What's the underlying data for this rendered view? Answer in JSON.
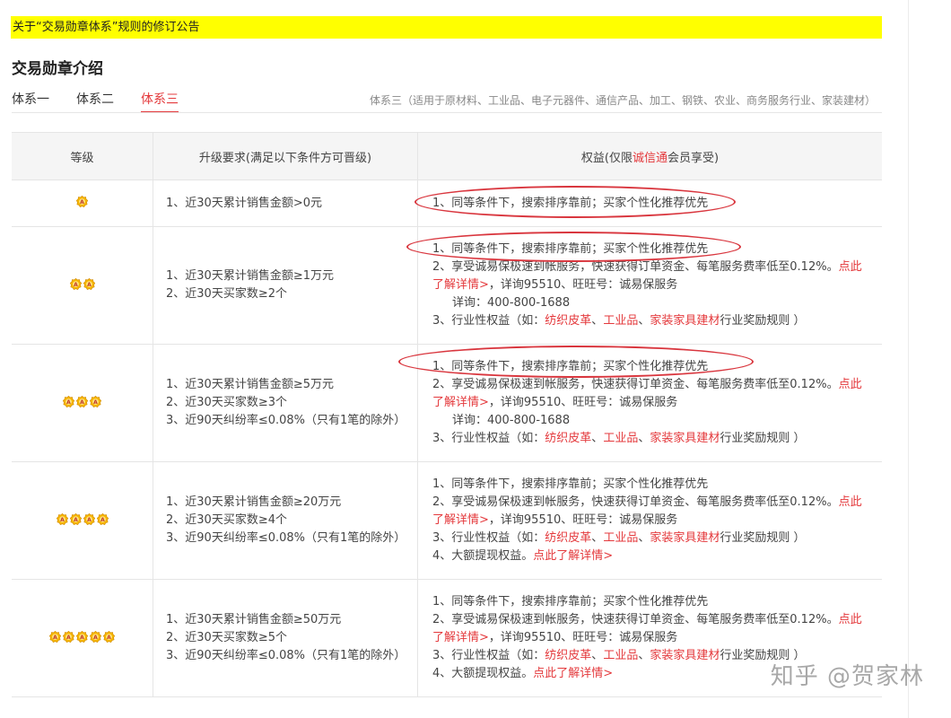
{
  "banner": {
    "text": "关于“交易勋章体系”规则的修订公告"
  },
  "section": {
    "title": "交易勋章介绍"
  },
  "tabs": [
    {
      "label": "体系一"
    },
    {
      "label": "体系二"
    },
    {
      "label": "体系三"
    }
  ],
  "tab_description": "体系三（适用于原材料、工业品、电子元器件、通信产品、加工、钢铁、农业、商务服务行业、家装建材）",
  "table": {
    "headers": {
      "level": "等级",
      "requirements": "升级要求(满足以下条件方可晋级)",
      "benefits_prefix": "权益(仅限",
      "benefits_highlight": "诚信通",
      "benefits_suffix": "会员享受)"
    },
    "rows": [
      {
        "medal_count": 1,
        "requirements": [
          "1、近30天累计销售金额>0元"
        ],
        "benefit_1": "1、同等条件下，搜索排序靠前；买家个性化推荐优先"
      },
      {
        "medal_count": 2,
        "requirements": [
          "1、近30天累计销售金额≥1万元",
          "2、近30天买家数≥2个"
        ],
        "benefit_1": "1、同等条件下，搜索排序靠前；买家个性化推荐优先",
        "benefit_2_text": "2、享受诚易保极速到帐服务，快速获得订单资金、每笔服务费率低至0.12%。",
        "benefit_2_link": "点此了解详情>",
        "benefit_2_tail": "，详询95510、旺旺号：诚易保服务",
        "benefit_2_extra": "详询：400-800-1688",
        "benefit_3_prefix": "3、行业性权益（如：",
        "benefit_3_links": [
          "纺织皮革",
          "工业品",
          "家装家具建材"
        ],
        "benefit_3_suffix": "行业奖励规则 ）"
      },
      {
        "medal_count": 3,
        "requirements": [
          "1、近30天累计销售金额≥5万元",
          "2、近30天买家数≥3个",
          "3、近90天纠纷率≤0.08%（只有1笔的除外）"
        ],
        "benefit_1": "1、同等条件下，搜索排序靠前；买家个性化推荐优先",
        "benefit_2_text": "2、享受诚易保极速到帐服务，快速获得订单资金、每笔服务费率低至0.12%。",
        "benefit_2_link": "点此了解详情>",
        "benefit_2_tail": "，详询95510、旺旺号：诚易保服务",
        "benefit_2_extra": "详询：400-800-1688",
        "benefit_3_prefix": "3、行业性权益（如：",
        "benefit_3_links": [
          "纺织皮革",
          "工业品",
          "家装家具建材"
        ],
        "benefit_3_suffix": "行业奖励规则 ）"
      },
      {
        "medal_count": 4,
        "requirements": [
          "1、近30天累计销售金额≥20万元",
          "2、近30天买家数≥4个",
          "3、近90天纠纷率≤0.08%（只有1笔的除外）"
        ],
        "benefit_1": "1、同等条件下，搜索排序靠前；买家个性化推荐优先",
        "benefit_2_text": "2、享受诚易保极速到帐服务，快速获得订单资金、每笔服务费率低至0.12%。",
        "benefit_2_link": "点此了解详情>",
        "benefit_2_tail": "，详询95510、旺旺号：诚易保服务",
        "benefit_3_prefix": "3、行业性权益（如：",
        "benefit_3_links": [
          "纺织皮革",
          "工业品",
          "家装家具建材"
        ],
        "benefit_3_suffix": "行业奖励规则 ）",
        "benefit_4_text": "4、大额提现权益。",
        "benefit_4_link": "点此了解详情>"
      },
      {
        "medal_count": 5,
        "requirements": [
          "1、近30天累计销售金额≥50万元",
          "2、近30天买家数≥5个",
          "3、近90天纠纷率≤0.08%（只有1笔的除外）"
        ],
        "benefit_1": "1、同等条件下，搜索排序靠前；买家个性化推荐优先",
        "benefit_2_text": "2、享受诚易保极速到帐服务，快速获得订单资金、每笔服务费率低至0.12%。",
        "benefit_2_link": "点此了解详情>",
        "benefit_2_tail": "，详询95510、旺旺号：诚易保服务",
        "benefit_3_prefix": "3、行业性权益（如：",
        "benefit_3_links": [
          "纺织皮革",
          "工业品",
          "家装家具建材"
        ],
        "benefit_3_suffix": "行业奖励规则 ）",
        "benefit_4_text": "4、大额提现权益。",
        "benefit_4_link": "点此了解详情>"
      }
    ]
  },
  "watermark": "知乎 @贺家林",
  "colors": {
    "banner_bg": "#ffff00",
    "link_red": "#e4393c",
    "annotation_red": "#d9363e",
    "header_bg": "#f5f5f5",
    "medal_gold": "#f6b500"
  },
  "icons": {
    "medal": "medal-icon"
  }
}
